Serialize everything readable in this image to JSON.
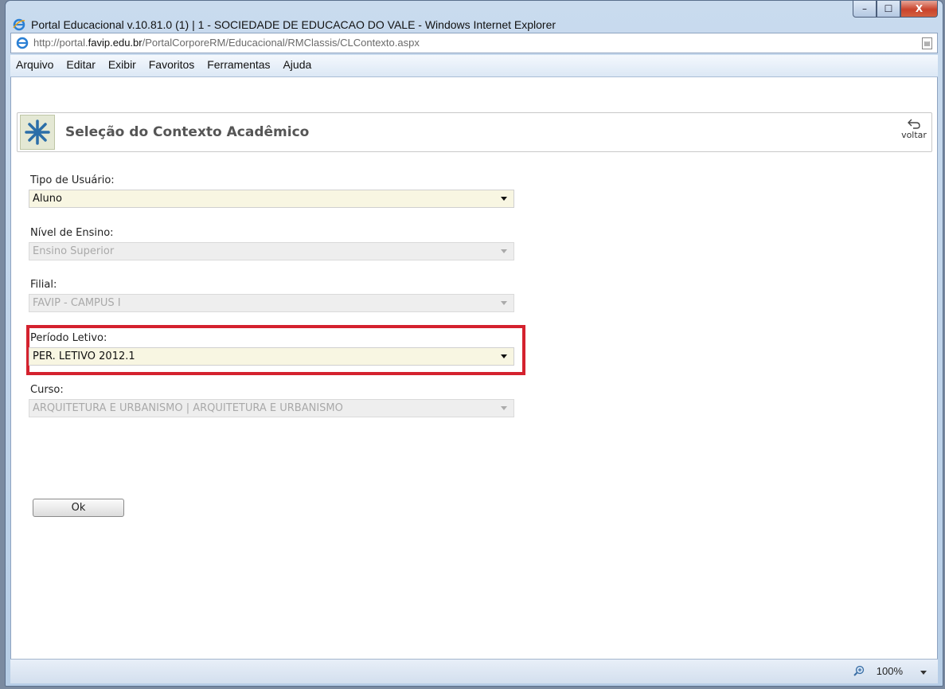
{
  "window": {
    "title": "Portal Educacional v.10.81.0 (1) | 1 - SOCIEDADE DE EDUCACAO DO VALE - Windows Internet Explorer",
    "minimize": "–",
    "maximize": "☐",
    "close": "X"
  },
  "address": {
    "url_prefix": "http://portal.",
    "url_domain": "favip.edu.br",
    "url_path": "/PortalCorporeRM/Educacional/RMClassis/CLContexto.aspx"
  },
  "menu": [
    "Arquivo",
    "Editar",
    "Exibir",
    "Favoritos",
    "Ferramentas",
    "Ajuda"
  ],
  "header": {
    "title": "Seleção do Contexto Acadêmico",
    "back_label": "voltar"
  },
  "form": {
    "tipo_usuario": {
      "label": "Tipo de Usuário:",
      "value": "Aluno"
    },
    "nivel_ensino": {
      "label": "Nível de Ensino:",
      "value": "Ensino Superior"
    },
    "filial": {
      "label": "Filial:",
      "value": "FAVIP - CAMPUS I"
    },
    "periodo_letivo": {
      "label": "Período Letivo:",
      "value": "PER. LETIVO 2012.1"
    },
    "curso": {
      "label": "Curso:",
      "value": "ARQUITETURA E URBANISMO | ARQUITETURA E URBANISMO"
    },
    "ok_label": "Ok"
  },
  "status": {
    "zoom": "100%"
  },
  "colors": {
    "highlight": "#d4222e",
    "active_field": "#f8f6e2"
  }
}
